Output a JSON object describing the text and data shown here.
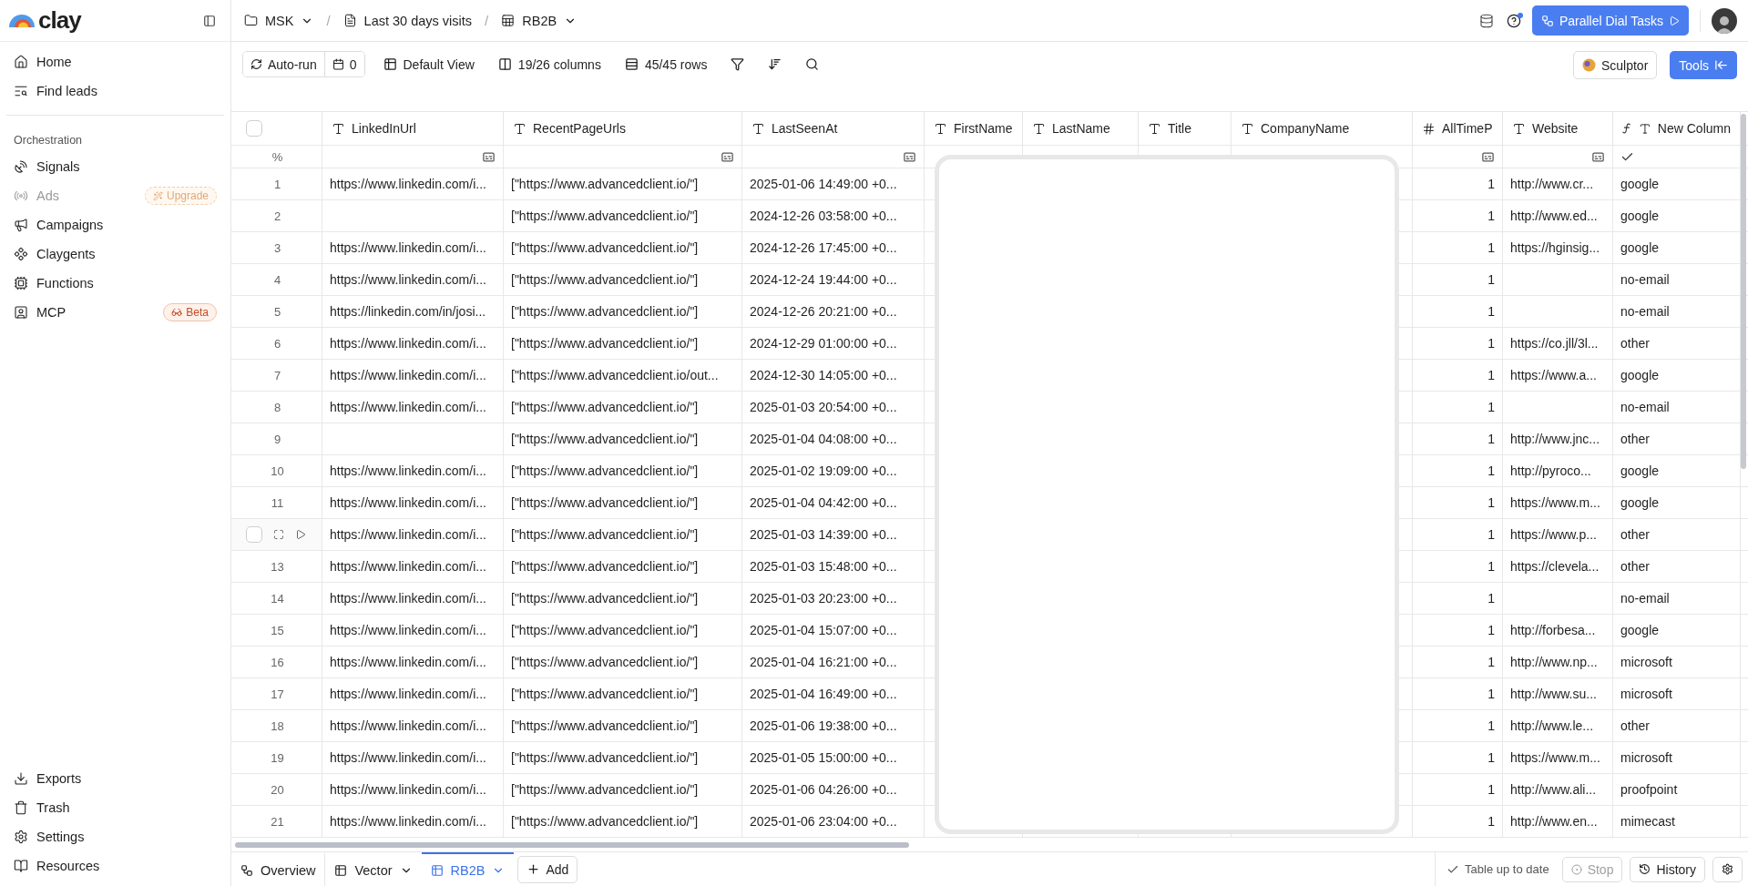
{
  "sidebar": {
    "logo": "clay",
    "items": [
      {
        "kind": "home",
        "label": "Home",
        "disabled": false
      },
      {
        "kind": "find",
        "label": "Find leads",
        "disabled": false
      }
    ],
    "section_label": "Orchestration",
    "section_items": [
      {
        "kind": "signals",
        "label": "Signals",
        "disabled": false
      },
      {
        "kind": "ads",
        "label": "Ads",
        "disabled": true,
        "badge": {
          "kind": "upgrade",
          "label": "Upgrade"
        }
      },
      {
        "kind": "campaigns",
        "label": "Campaigns",
        "disabled": false
      },
      {
        "kind": "claygents",
        "label": "Claygents",
        "disabled": false
      },
      {
        "kind": "functions",
        "label": "Functions",
        "disabled": false
      },
      {
        "kind": "mcp",
        "label": "MCP",
        "disabled": false,
        "badge": {
          "kind": "beta",
          "label": "Beta"
        }
      }
    ],
    "bottom_items": [
      {
        "kind": "exports",
        "label": "Exports",
        "disabled": false
      },
      {
        "kind": "trash",
        "label": "Trash",
        "disabled": false
      },
      {
        "kind": "settings",
        "label": "Settings",
        "disabled": false
      },
      {
        "kind": "resources",
        "label": "Resources",
        "disabled": false
      }
    ]
  },
  "breadcrumb": [
    {
      "kind": "folder",
      "label": "MSK",
      "dropdown": true
    },
    {
      "kind": "doc",
      "label": "Last 30 days visits",
      "dropdown": false
    },
    {
      "kind": "table",
      "label": "RB2B",
      "dropdown": true
    }
  ],
  "breadcrumb_separator": "/",
  "top_actions": {
    "primary_button": "Parallel Dial Tasks",
    "help_notification": true
  },
  "toolbar": {
    "auto_run": "Auto-run",
    "run_count": "0",
    "view": "Default View",
    "columns": "19/26 columns",
    "rows": "45/45 rows",
    "sculptor": "Sculptor",
    "tools": "Tools"
  },
  "table": {
    "select_all_checked": false,
    "summary_label": "%",
    "columns": [
      {
        "kind": "text",
        "label": "LinkedInUrl",
        "summary": {
          "kind": "list"
        }
      },
      {
        "kind": "text",
        "label": "RecentPageUrls",
        "summary": {
          "kind": "list"
        }
      },
      {
        "kind": "text",
        "label": "LastSeenAt",
        "summary": {
          "kind": "list"
        }
      },
      {
        "kind": "text",
        "label": "FirstName"
      },
      {
        "kind": "text",
        "label": "LastName"
      },
      {
        "kind": "text",
        "label": "Title"
      },
      {
        "kind": "text",
        "label": "CompanyName"
      },
      {
        "kind": "number",
        "label": "AllTimeP",
        "summary": {
          "kind": "list"
        }
      },
      {
        "kind": "text",
        "label": "Website",
        "summary": {
          "kind": "list"
        }
      },
      {
        "kind": "formula",
        "label": "New Column",
        "summary": {
          "kind": "check"
        }
      }
    ],
    "rows": [
      {
        "number": "1",
        "hovered": false,
        "linkedin_url": "https://www.linkedin.com/i...",
        "recent_page_urls": "[\"https://www.advancedclient.io/\"]",
        "last_seen_at": "2025-01-06 14:49:00 +0...",
        "all_time": "1",
        "website": "http://www.cr...",
        "new_column": "google"
      },
      {
        "number": "2",
        "hovered": false,
        "linkedin_url": "",
        "recent_page_urls": "[\"https://www.advancedclient.io/\"]",
        "last_seen_at": "2024-12-26 03:58:00 +0...",
        "all_time": "1",
        "website": "http://www.ed...",
        "new_column": "google"
      },
      {
        "number": "3",
        "hovered": false,
        "linkedin_url": "https://www.linkedin.com/i...",
        "recent_page_urls": "[\"https://www.advancedclient.io/\"]",
        "last_seen_at": "2024-12-26 17:45:00 +0...",
        "all_time": "1",
        "website": "https://hginsig...",
        "new_column": "google"
      },
      {
        "number": "4",
        "hovered": false,
        "linkedin_url": "https://www.linkedin.com/i...",
        "recent_page_urls": "[\"https://www.advancedclient.io/\"]",
        "last_seen_at": "2024-12-24 19:44:00 +0...",
        "all_time": "1",
        "website": "",
        "new_column": "no-email"
      },
      {
        "number": "5",
        "hovered": false,
        "linkedin_url": "https://linkedin.com/in/josi...",
        "recent_page_urls": "[\"https://www.advancedclient.io/\"]",
        "last_seen_at": "2024-12-26 20:21:00 +0...",
        "all_time": "1",
        "website": "",
        "new_column": "no-email"
      },
      {
        "number": "6",
        "hovered": false,
        "linkedin_url": "https://www.linkedin.com/i...",
        "recent_page_urls": "[\"https://www.advancedclient.io/\"]",
        "last_seen_at": "2024-12-29 01:00:00 +0...",
        "all_time": "1",
        "website": "https://co.jll/3l...",
        "new_column": "other"
      },
      {
        "number": "7",
        "hovered": false,
        "linkedin_url": "https://www.linkedin.com/i...",
        "recent_page_urls": "[\"https://www.advancedclient.io/out...",
        "last_seen_at": "2024-12-30 14:05:00 +0...",
        "all_time": "1",
        "website": "https://www.a...",
        "new_column": "google"
      },
      {
        "number": "8",
        "hovered": false,
        "linkedin_url": "https://www.linkedin.com/i...",
        "recent_page_urls": "[\"https://www.advancedclient.io/\"]",
        "last_seen_at": "2025-01-03 20:54:00 +0...",
        "all_time": "1",
        "website": "",
        "new_column": "no-email"
      },
      {
        "number": "9",
        "hovered": false,
        "linkedin_url": "",
        "recent_page_urls": "[\"https://www.advancedclient.io/\"]",
        "last_seen_at": "2025-01-04 04:08:00 +0...",
        "all_time": "1",
        "website": "http://www.jnc...",
        "new_column": "other"
      },
      {
        "number": "10",
        "hovered": false,
        "linkedin_url": "https://www.linkedin.com/i...",
        "recent_page_urls": "[\"https://www.advancedclient.io/\"]",
        "last_seen_at": "2025-01-02 19:09:00 +0...",
        "all_time": "1",
        "website": "http://pyroco...",
        "new_column": "google"
      },
      {
        "number": "11",
        "hovered": false,
        "linkedin_url": "https://www.linkedin.com/i...",
        "recent_page_urls": "[\"https://www.advancedclient.io/\"]",
        "last_seen_at": "2025-01-04 04:42:00 +0...",
        "all_time": "1",
        "website": "https://www.m...",
        "new_column": "google"
      },
      {
        "hovered": true,
        "linkedin_url": "https://www.linkedin.com/i...",
        "recent_page_urls": "[\"https://www.advancedclient.io/\"]",
        "last_seen_at": "2025-01-03 14:39:00 +0...",
        "all_time": "1",
        "website": "https://www.p...",
        "new_column": "other"
      },
      {
        "number": "13",
        "hovered": false,
        "linkedin_url": "https://www.linkedin.com/i...",
        "recent_page_urls": "[\"https://www.advancedclient.io/\"]",
        "last_seen_at": "2025-01-03 15:48:00 +0...",
        "all_time": "1",
        "website": "https://clevela...",
        "new_column": "other"
      },
      {
        "number": "14",
        "hovered": false,
        "linkedin_url": "https://www.linkedin.com/i...",
        "recent_page_urls": "[\"https://www.advancedclient.io/\"]",
        "last_seen_at": "2025-01-03 20:23:00 +0...",
        "all_time": "1",
        "website": "",
        "new_column": "no-email"
      },
      {
        "number": "15",
        "hovered": false,
        "linkedin_url": "https://www.linkedin.com/i...",
        "recent_page_urls": "[\"https://www.advancedclient.io/\"]",
        "last_seen_at": "2025-01-04 15:07:00 +0...",
        "all_time": "1",
        "website": "http://forbesa...",
        "new_column": "google"
      },
      {
        "number": "16",
        "hovered": false,
        "linkedin_url": "https://www.linkedin.com/i...",
        "recent_page_urls": "[\"https://www.advancedclient.io/\"]",
        "last_seen_at": "2025-01-04 16:21:00 +0...",
        "all_time": "1",
        "website": "http://www.np...",
        "new_column": "microsoft"
      },
      {
        "number": "17",
        "hovered": false,
        "linkedin_url": "https://www.linkedin.com/i...",
        "recent_page_urls": "[\"https://www.advancedclient.io/\"]",
        "last_seen_at": "2025-01-04 16:49:00 +0...",
        "all_time": "1",
        "website": "http://www.su...",
        "new_column": "microsoft"
      },
      {
        "number": "18",
        "hovered": false,
        "linkedin_url": "https://www.linkedin.com/i...",
        "recent_page_urls": "[\"https://www.advancedclient.io/\"]",
        "last_seen_at": "2025-01-06 19:38:00 +0...",
        "all_time": "1",
        "website": "http://www.le...",
        "new_column": "other"
      },
      {
        "number": "19",
        "hovered": false,
        "linkedin_url": "https://www.linkedin.com/i...",
        "recent_page_urls": "[\"https://www.advancedclient.io/\"]",
        "last_seen_at": "2025-01-05 15:00:00 +0...",
        "all_time": "1",
        "website": "https://www.m...",
        "new_column": "microsoft"
      },
      {
        "number": "20",
        "hovered": false,
        "linkedin_url": "https://www.linkedin.com/i...",
        "recent_page_urls": "[\"https://www.advancedclient.io/\"]",
        "last_seen_at": "2025-01-06 04:26:00 +0...",
        "all_time": "1",
        "website": "http://www.ali...",
        "new_column": "proofpoint"
      },
      {
        "number": "21",
        "hovered": false,
        "linkedin_url": "https://www.linkedin.com/i...",
        "recent_page_urls": "[\"https://www.advancedclient.io/\"]",
        "last_seen_at": "2025-01-06 23:04:00 +0...",
        "all_time": "1",
        "website": "http://www.en...",
        "new_column": "mimecast"
      }
    ]
  },
  "bottom_tabs": [
    {
      "kind": "overview",
      "label": "Overview",
      "selected": false,
      "dropdown": false
    },
    {
      "kind": "table",
      "label": "Vector",
      "selected": false,
      "dropdown": true
    },
    {
      "kind": "table",
      "label": "RB2B",
      "selected": true,
      "dropdown": true
    }
  ],
  "add_button": "Add",
  "status": {
    "text": "Table up to date",
    "stop": "Stop",
    "stop_disabled": true,
    "history": "History"
  }
}
